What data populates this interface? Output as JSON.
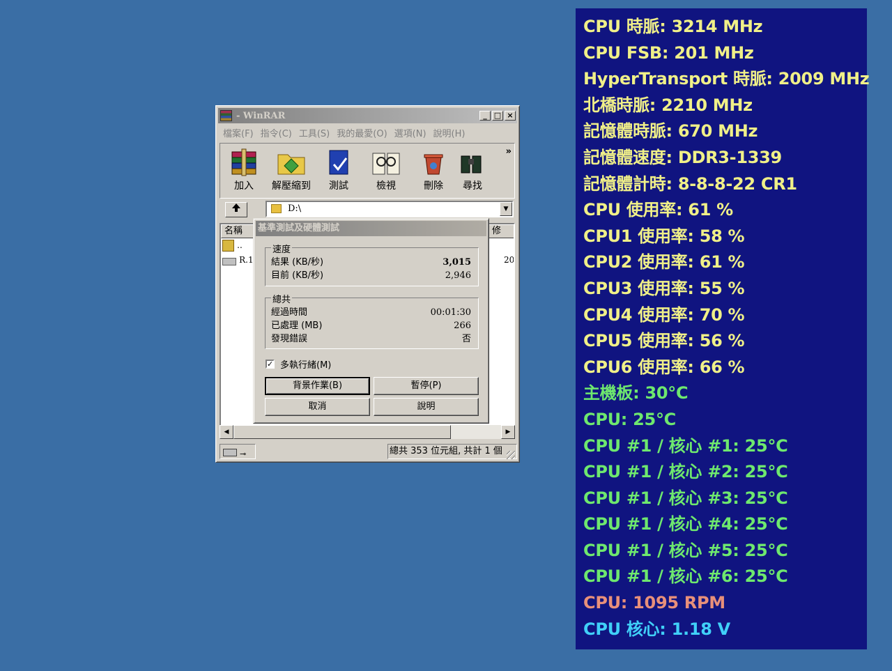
{
  "osd": {
    "background": "#101480",
    "lines": [
      {
        "text": "CPU 時脈: 3214 MHz",
        "color": "#f0f088"
      },
      {
        "text": "CPU FSB: 201 MHz",
        "color": "#f0f088"
      },
      {
        "text": "HyperTransport 時脈: 2009 MHz",
        "color": "#f0f088"
      },
      {
        "text": "北橋時脈: 2210 MHz",
        "color": "#f0f088"
      },
      {
        "text": "記憶體時脈: 670 MHz",
        "color": "#f0f088"
      },
      {
        "text": "記憶體速度: DDR3-1339",
        "color": "#f0f088"
      },
      {
        "text": "記憶體計時: 8-8-8-22 CR1",
        "color": "#f0f088"
      },
      {
        "text": "CPU 使用率: 61 %",
        "color": "#f0f088"
      },
      {
        "text": "CPU1 使用率: 58 %",
        "color": "#f0f088"
      },
      {
        "text": "CPU2 使用率: 61 %",
        "color": "#f0f088"
      },
      {
        "text": "CPU3 使用率: 55 %",
        "color": "#f0f088"
      },
      {
        "text": "CPU4 使用率: 70 %",
        "color": "#f0f088"
      },
      {
        "text": "CPU5 使用率: 56 %",
        "color": "#f0f088"
      },
      {
        "text": "CPU6 使用率: 66 %",
        "color": "#f0f088"
      },
      {
        "text": "主機板: 30°C",
        "color": "#6ee86e"
      },
      {
        "text": "CPU: 25°C",
        "color": "#6ee86e"
      },
      {
        "text": "CPU #1 / 核心 #1: 25°C",
        "color": "#6ee86e"
      },
      {
        "text": "CPU #1 / 核心 #2: 25°C",
        "color": "#6ee86e"
      },
      {
        "text": "CPU #1 / 核心 #3: 25°C",
        "color": "#6ee86e"
      },
      {
        "text": "CPU #1 / 核心 #4: 25°C",
        "color": "#6ee86e"
      },
      {
        "text": "CPU #1 / 核心 #5: 25°C",
        "color": "#6ee86e"
      },
      {
        "text": "CPU #1 / 核心 #6: 25°C",
        "color": "#6ee86e"
      },
      {
        "text": "CPU: 1095 RPM",
        "color": "#e8907a"
      },
      {
        "text": "CPU 核心: 1.18 V",
        "color": "#40d0f8"
      }
    ]
  },
  "winrar": {
    "title": "- WinRAR",
    "menu": [
      "檔案(F)",
      "指令(C)",
      "工具(S)",
      "我的最愛(O)",
      "選項(N)",
      "說明(H)"
    ],
    "toolbar": [
      "加入",
      "解壓縮到",
      "測試",
      "檢視",
      "刪除",
      "尋找"
    ],
    "toolbar_more": "»",
    "address": "D:\\",
    "columns": {
      "name": "名稱",
      "right": "修"
    },
    "files": [
      {
        "name": "..",
        "extra": ""
      },
      {
        "name": "R.1",
        "extra": "20"
      }
    ],
    "status": "總共 353 位元組, 共計 1 個"
  },
  "bench": {
    "title": "基準測試及硬體測試",
    "speed": {
      "label": "速度",
      "result_label": "結果 (KB/秒)",
      "result_value": "3,015",
      "current_label": "目前 (KB/秒)",
      "current_value": "2,946"
    },
    "total": {
      "label": "總共",
      "elapsed_label": "經過時間",
      "elapsed_value": "00:01:30",
      "processed_label": "已處理 (MB)",
      "processed_value": "266",
      "errors_label": "發現錯誤",
      "errors_value": "否"
    },
    "multithread": {
      "label": "多執行緒(M)",
      "checked": true
    },
    "buttons": {
      "background": "背景作業(B)",
      "pause": "暫停(P)",
      "cancel": "取消",
      "help": "說明"
    }
  }
}
